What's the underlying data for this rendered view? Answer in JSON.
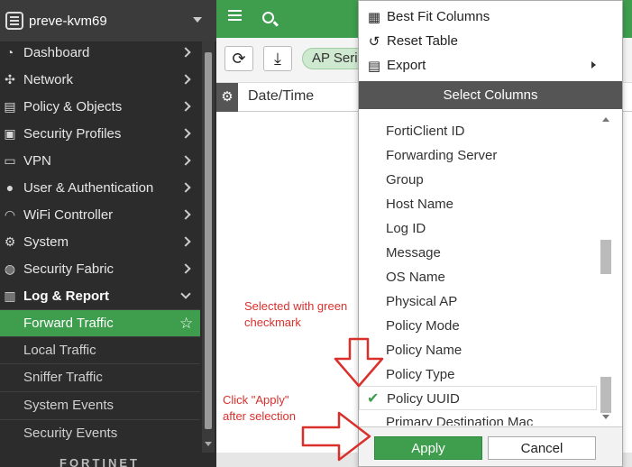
{
  "sidebar": {
    "device_name": "preve-kvm69",
    "nav": [
      {
        "label": "Dashboard",
        "icon": "dashboard-icon"
      },
      {
        "label": "Network",
        "icon": "network-icon"
      },
      {
        "label": "Policy & Objects",
        "icon": "policy-icon"
      },
      {
        "label": "Security Profiles",
        "icon": "lock-icon"
      },
      {
        "label": "VPN",
        "icon": "monitor-icon"
      },
      {
        "label": "User & Authentication",
        "icon": "user-icon"
      },
      {
        "label": "WiFi Controller",
        "icon": "wifi-icon"
      },
      {
        "label": "System",
        "icon": "gear-icon"
      },
      {
        "label": "Security Fabric",
        "icon": "fabric-icon"
      },
      {
        "label": "Log & Report",
        "icon": "chart-icon"
      }
    ],
    "subnav": [
      {
        "label": "Forward Traffic",
        "active": true
      },
      {
        "label": "Local Traffic"
      },
      {
        "label": "Sniffer Traffic"
      },
      {
        "label": "System Events"
      },
      {
        "label": "Security Events"
      }
    ],
    "brand": "FORTINET"
  },
  "toolbar": {
    "ap_chip": "AP Seri"
  },
  "table": {
    "first_column": "Date/Time"
  },
  "panel": {
    "menu": [
      {
        "label": "Best Fit Columns",
        "icon": "grid-icon"
      },
      {
        "label": "Reset Table",
        "icon": "undo-icon"
      },
      {
        "label": "Export",
        "icon": "document-icon"
      }
    ],
    "select_columns_title": "Select Columns",
    "columns": [
      {
        "label": "FortiClient ID"
      },
      {
        "label": "Forwarding Server"
      },
      {
        "label": "Group"
      },
      {
        "label": "Host Name"
      },
      {
        "label": "Log ID"
      },
      {
        "label": "Message"
      },
      {
        "label": "OS Name"
      },
      {
        "label": "Physical AP"
      },
      {
        "label": "Policy Mode"
      },
      {
        "label": "Policy Name"
      },
      {
        "label": "Policy Type"
      },
      {
        "label": "Policy UUID",
        "selected": true
      },
      {
        "label": "Primary Destination Mac"
      }
    ],
    "apply_label": "Apply",
    "cancel_label": "Cancel"
  },
  "annotations": {
    "note_selected": "Selected with green\ncheckmark",
    "note_apply": "Click \"Apply\"\nafter selection",
    "color": "#d9302c"
  },
  "colors": {
    "accent_green": "#3e9e4d",
    "sidebar_bg": "#2c2c2c"
  }
}
